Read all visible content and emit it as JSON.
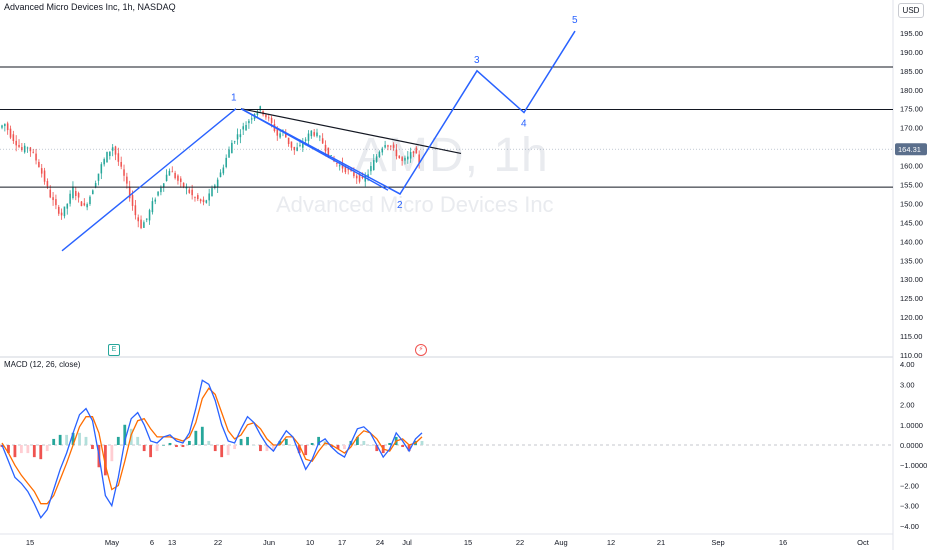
{
  "header": {
    "symbol_title": "Advanced Micro Devices Inc, 1h, NASDAQ",
    "currency_button": "USD"
  },
  "watermark": {
    "symbol": "AMD, 1h",
    "name": "Advanced Micro Devices Inc"
  },
  "events": {
    "earnings": "E",
    "dividend": "⚡"
  },
  "colors": {
    "up": "#26a69a",
    "down": "#ef5350",
    "drawing": "#2962ff",
    "macd_line": "#2962ff",
    "signal_line": "#ff6d00",
    "last_price_bg": "#5b6f8c"
  },
  "chart_data": [
    {
      "type": "candlestick",
      "title": "Advanced Micro Devices Inc, 1h, NASDAQ",
      "ylim": [
        110,
        200
      ],
      "y_ticks": [
        "110.00",
        "115.00",
        "120.00",
        "125.00",
        "130.00",
        "135.00",
        "140.00",
        "145.00",
        "150.00",
        "155.00",
        "160.00",
        "165.00",
        "170.00",
        "175.00",
        "180.00",
        "185.00",
        "190.00",
        "195.00",
        "200.00"
      ],
      "x_ticks": [
        "15",
        "May",
        "6",
        "13",
        "22",
        "Jun",
        "10",
        "17",
        "24",
        "Jul",
        "15",
        "22",
        "Aug",
        "12",
        "21",
        "Sep",
        "16",
        "Oct"
      ],
      "last_price": "164.31",
      "price_path": [
        170,
        171,
        168,
        166,
        164,
        165,
        163,
        160,
        156,
        152,
        149,
        147,
        150,
        154,
        151,
        149,
        152,
        156,
        160,
        163,
        165,
        161,
        157,
        152,
        147,
        144,
        146,
        150,
        153,
        156,
        159,
        157,
        155,
        154,
        152,
        151,
        150,
        152,
        155,
        158,
        162,
        166,
        168,
        170,
        172,
        174,
        175,
        173,
        171,
        168,
        169,
        166,
        164,
        165,
        167,
        169,
        168,
        166,
        163,
        161,
        160,
        159,
        158,
        157,
        156,
        158,
        161,
        164,
        166,
        165,
        163,
        161,
        162,
        164,
        161
      ],
      "horizontal_lines": [
        186,
        174.8,
        154.3
      ],
      "trendlines": [
        {
          "from": [
            0.0,
            137.5
          ],
          "to": [
            0.0,
            175
          ]
        },
        {
          "from": [
            0.0,
            175
          ],
          "to": [
            0.0,
            152.5
          ]
        },
        {
          "from": [
            0.0,
            175
          ],
          "to": [
            0.0,
            163
          ]
        }
      ],
      "wave_projection": {
        "points": [
          [
            23,
            175
          ],
          [
            45,
            152.5
          ],
          [
            53,
            185
          ],
          [
            59,
            174
          ],
          [
            65,
            195.5
          ]
        ],
        "labels": [
          "1",
          "2",
          "3",
          "4",
          "5"
        ]
      }
    },
    {
      "type": "line",
      "title": "MACD (12, 26, close)",
      "ylim": [
        -4.3,
        4.3
      ],
      "y_ticks": [
        "4.00",
        "3.00",
        "2.00",
        "1.0000",
        "0.0000",
        "−1.0000",
        "−2.00",
        "−3.00",
        "−4.00"
      ],
      "series": [
        {
          "name": "MACD",
          "values": [
            0.0,
            -0.8,
            -1.6,
            -1.9,
            -2.3,
            -2.9,
            -3.6,
            -3.2,
            -2.2,
            -1.2,
            -0.4,
            0.6,
            1.5,
            1.8,
            1.2,
            -0.5,
            -2.5,
            -3.0,
            -1.6,
            0.2,
            1.3,
            1.6,
            1.0,
            0.2,
            0.1,
            0.4,
            0.5,
            0.2,
            0.1,
            0.6,
            1.8,
            3.2,
            3.0,
            2.2,
            1.0,
            0.2,
            0.1,
            0.8,
            1.4,
            1.1,
            0.5,
            0.0,
            -0.3,
            0.2,
            0.7,
            0.4,
            -0.4,
            -1.2,
            -0.7,
            0.1,
            0.3,
            -0.1,
            -0.4,
            -0.6,
            0.1,
            0.8,
            0.9,
            0.6,
            0.0,
            -0.6,
            -0.2,
            0.6,
            0.2,
            -0.3,
            0.3,
            0.6
          ]
        },
        {
          "name": "Signal",
          "values": [
            0.1,
            -0.4,
            -1.0,
            -1.5,
            -1.9,
            -2.3,
            -2.9,
            -2.9,
            -2.5,
            -1.7,
            -0.9,
            0.0,
            0.9,
            1.4,
            1.4,
            0.6,
            -1.0,
            -2.2,
            -2.0,
            -0.8,
            0.5,
            1.2,
            1.3,
            0.8,
            0.4,
            0.4,
            0.4,
            0.3,
            0.2,
            0.4,
            1.1,
            2.3,
            2.8,
            2.5,
            1.6,
            0.7,
            0.3,
            0.5,
            1.0,
            1.1,
            0.8,
            0.3,
            0.0,
            0.0,
            0.4,
            0.4,
            0.0,
            -0.7,
            -0.8,
            -0.3,
            0.1,
            0.0,
            -0.2,
            -0.4,
            -0.1,
            0.4,
            0.7,
            0.6,
            0.3,
            -0.2,
            -0.3,
            0.2,
            0.3,
            0.0,
            0.1,
            0.4
          ]
        }
      ]
    }
  ]
}
